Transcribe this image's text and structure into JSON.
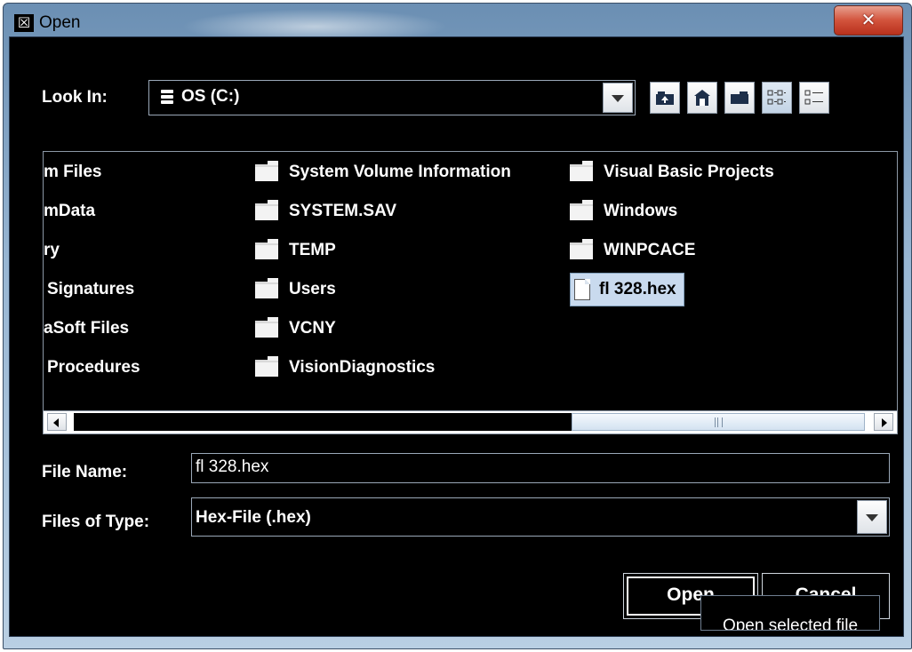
{
  "window": {
    "title": "Open",
    "close_glyph": "✕"
  },
  "toolbar": {
    "look_in_label": "Look In:",
    "look_in_value": "OS (C:)",
    "buttons": [
      "up-one-level-icon",
      "home-icon",
      "new-folder-icon",
      "list-view-icon",
      "details-view-icon"
    ]
  },
  "files": {
    "col1": [
      "m Files",
      "mData",
      "ry",
      "Signatures",
      "aSoft Files",
      "Procedures"
    ],
    "col2": [
      "System Volume Information",
      "SYSTEM.SAV",
      "TEMP",
      "Users",
      "VCNY",
      "VisionDiagnostics"
    ],
    "col3": [
      "Visual Basic Projects",
      "Windows",
      "WINPCACE",
      "fl 328.hex"
    ],
    "selected": "fl 328.hex"
  },
  "file_name": {
    "label": "File Name:",
    "value": "fl 328.hex"
  },
  "file_type": {
    "label": "Files of Type:",
    "value": "Hex-File (.hex)"
  },
  "buttons": {
    "open": "Open",
    "cancel": "Cancel"
  },
  "tooltip": "Open selected file",
  "colors": {
    "background": "#000000",
    "selection": "#c9daee",
    "text": "#ffffff",
    "close_button": "#c7422a"
  }
}
